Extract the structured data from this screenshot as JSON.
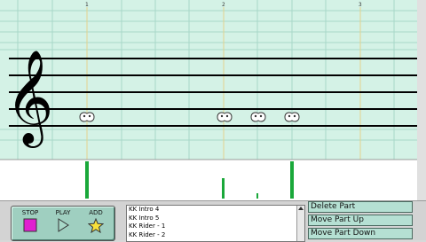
{
  "score": {
    "measure_numbers": [
      "1",
      "2",
      "3"
    ],
    "clef": "treble-clef-icon",
    "note_icon": "cat-paw-note-icon",
    "colors": {
      "staff_bg": "#d4f2e6",
      "grid_line": "#a8d8c8",
      "beat_line": "#e8d89a",
      "staff_line": "#000000",
      "velocity_bar": "#1aa83a"
    }
  },
  "transport": {
    "stop_label": "STOP",
    "play_label": "PLAY",
    "add_label": "ADD"
  },
  "parts": {
    "items": [
      "KK Intro 4",
      "KK Intro 5",
      "KK Rider - 1",
      "KK Rider - 2"
    ]
  },
  "actions": {
    "delete": "Delete Part",
    "move_up": "Move Part Up",
    "move_down": "Move Part Down"
  }
}
